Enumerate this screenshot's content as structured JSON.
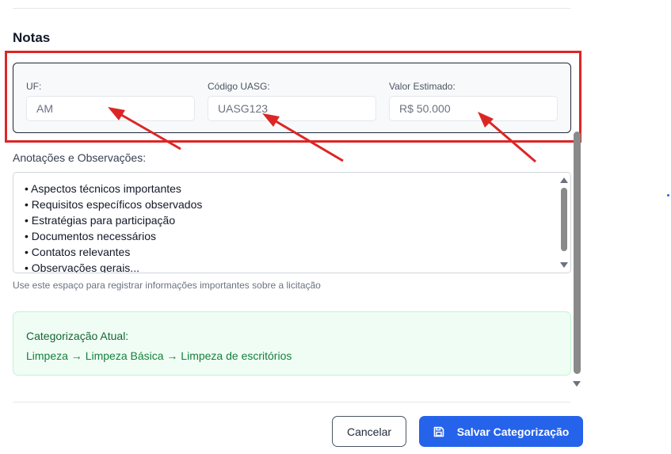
{
  "section": {
    "title": "Notas"
  },
  "fields": {
    "uf": {
      "label": "UF:",
      "value": "AM"
    },
    "uasg": {
      "label": "Código UASG:",
      "value": "UASG123"
    },
    "valor": {
      "label": "Valor Estimado:",
      "value": "R$ 50.000"
    }
  },
  "notes": {
    "label": "Anotações e Observações:",
    "items": [
      "Aspectos técnicos importantes",
      "Requisitos específicos observados",
      "Estratégias para participação",
      "Documentos necessários",
      "Contatos relevantes",
      "Observações gerais..."
    ],
    "help": "Use este espaço para registrar informações importantes sobre a licitação"
  },
  "categorization": {
    "title": "Categorização Atual:",
    "path": "Limpeza → Limpeza Básica → Limpeza de escritórios"
  },
  "footer": {
    "cancel_label": "Cancelar",
    "save_label": "Salvar Categorização",
    "save_icon": "save-icon"
  },
  "colors": {
    "annotation": "#dc2626",
    "primary": "#2563eb",
    "success_text": "#15803d"
  }
}
